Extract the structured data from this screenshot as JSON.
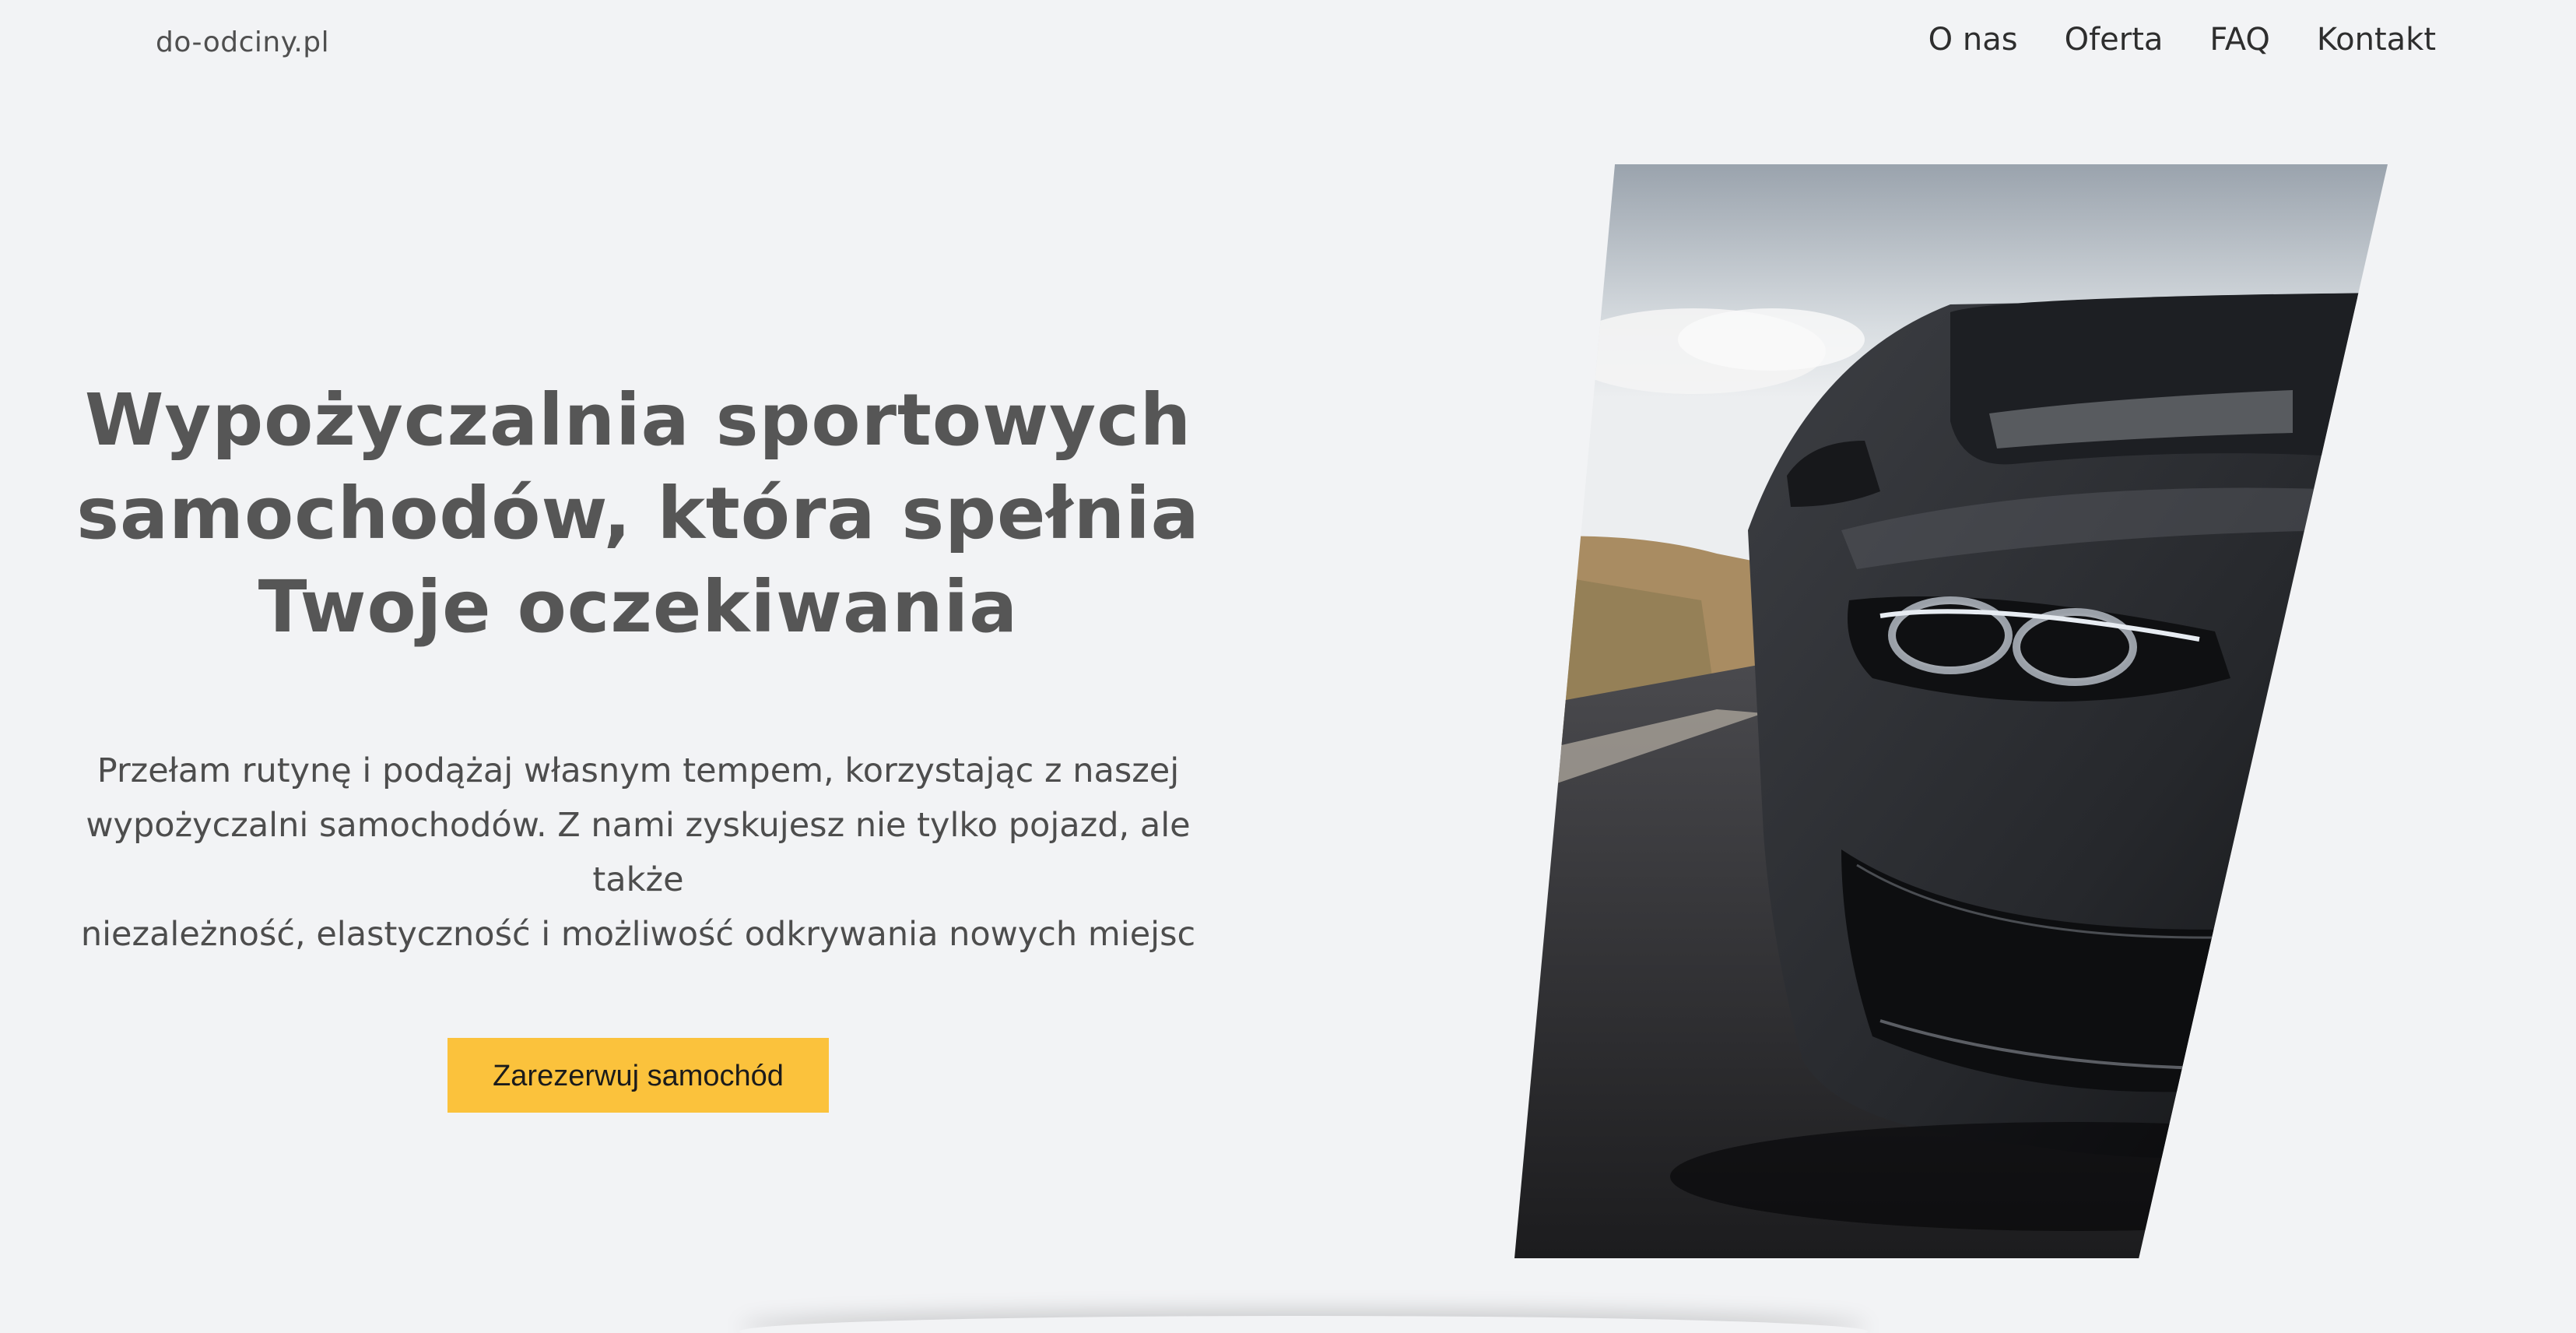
{
  "header": {
    "logo": "do-odciny.pl",
    "nav": [
      {
        "label": "O nas"
      },
      {
        "label": "Oferta"
      },
      {
        "label": "FAQ"
      },
      {
        "label": "Kontakt"
      }
    ]
  },
  "hero": {
    "title_lines": [
      "Wypożyczalnia sportowych",
      "samochodów, która spełnia",
      "Twoje oczekiwania"
    ],
    "text_lines": [
      "Przełam rutynę i podążaj własnym tempem, korzystając z naszej",
      "wypożyczalni samochodów. Z nami zyskujesz nie tylko pojazd, ale także",
      "niezależność, elastyczność i możliwość odkrywania nowych miejsc"
    ],
    "cta_label": "Zarezerwuj samochód",
    "image": "black-sports-car-photo"
  },
  "colors": {
    "background": "#f2f3f5",
    "accent": "#fbc23c",
    "heading": "#565656"
  }
}
